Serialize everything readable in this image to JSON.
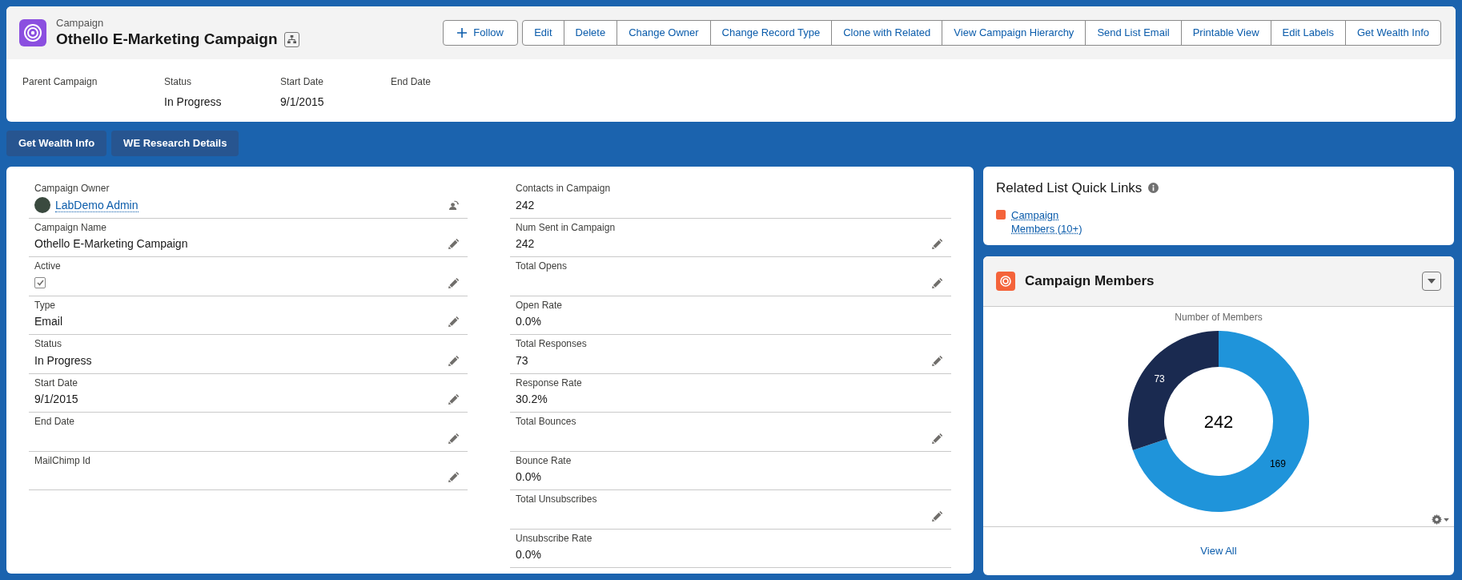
{
  "record": {
    "object_type": "Campaign",
    "title": "Othello E-Marketing Campaign"
  },
  "follow_button": {
    "label": "Follow"
  },
  "actions": [
    "Edit",
    "Delete",
    "Change Owner",
    "Change Record Type",
    "Clone with Related",
    "View Campaign Hierarchy",
    "Send List Email",
    "Printable View",
    "Edit Labels",
    "Get Wealth Info"
  ],
  "highlights": [
    {
      "label": "Parent Campaign"
    },
    {
      "label": "Status",
      "value": "In Progress"
    },
    {
      "label": "Start Date",
      "value": "9/1/2015"
    },
    {
      "label": "End Date"
    }
  ],
  "quick_actions": [
    "Get Wealth Info",
    "WE Research Details"
  ],
  "fields_left": [
    {
      "kind": "user",
      "label": "Campaign Owner",
      "value": "LabDemo Admin"
    },
    {
      "kind": "text",
      "label": "Campaign Name",
      "value": "Othello E-Marketing Campaign",
      "editable": true
    },
    {
      "kind": "checkbox",
      "label": "Active",
      "checked": true,
      "editable": true
    },
    {
      "kind": "text",
      "label": "Type",
      "value": "Email",
      "editable": true
    },
    {
      "kind": "text",
      "label": "Status",
      "value": "In Progress",
      "editable": true
    },
    {
      "kind": "text",
      "label": "Start Date",
      "value": "9/1/2015",
      "editable": true
    },
    {
      "kind": "text",
      "label": "End Date",
      "editable": true
    },
    {
      "kind": "text",
      "label": "MailChimp Id",
      "editable": true
    }
  ],
  "fields_right": [
    {
      "kind": "text",
      "label": "Contacts in Campaign",
      "value": "242",
      "editable": false
    },
    {
      "kind": "text",
      "label": "Num Sent in Campaign",
      "value": "242",
      "editable": true
    },
    {
      "kind": "text",
      "label": "Total Opens",
      "editable": true
    },
    {
      "kind": "text",
      "label": "Open Rate",
      "value": "0.0%",
      "editable": false
    },
    {
      "kind": "text",
      "label": "Total Responses",
      "value": "73",
      "editable": true
    },
    {
      "kind": "text",
      "label": "Response Rate",
      "value": "30.2%",
      "editable": false
    },
    {
      "kind": "text",
      "label": "Total Bounces",
      "editable": true
    },
    {
      "kind": "text",
      "label": "Bounce Rate",
      "value": "0.0%",
      "editable": false
    },
    {
      "kind": "text",
      "label": "Total Unsubscribes",
      "editable": true
    },
    {
      "kind": "text",
      "label": "Unsubscribe Rate",
      "value": "0.0%",
      "editable": false
    }
  ],
  "quick_links": {
    "title": "Related List Quick Links",
    "links": [
      "Campaign Members (10+)"
    ]
  },
  "members_card": {
    "title": "Campaign Members",
    "center_label": "242",
    "footer_link": "View All",
    "chart_data": {
      "type": "donut",
      "title": "Number of Members",
      "values": [
        169,
        73
      ],
      "data_labels": true
    }
  }
}
